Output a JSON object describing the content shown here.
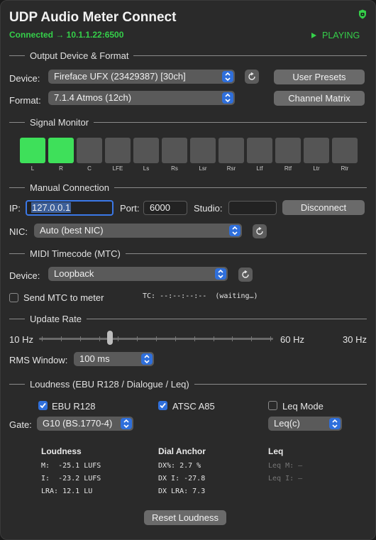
{
  "app_title": "UDP Audio Meter Connect",
  "status": "Connected → 10.1.1.22:6500",
  "playing_label": "PLAYING",
  "colors": {
    "accent_green": "#35d04a",
    "meter_on": "#3ee05a",
    "meter_off": "#555555",
    "select_blue": "#2f6fdb"
  },
  "output": {
    "section_title": "Output Device & Format",
    "device_label": "Device:",
    "device_value": "Fireface UFX (23429387)  [30ch]",
    "format_label": "Format:",
    "format_value": "7.1.4 Atmos (12ch)",
    "user_presets_label": "User Presets",
    "channel_matrix_label": "Channel Matrix"
  },
  "signal_monitor": {
    "section_title": "Signal Monitor",
    "channels": [
      {
        "name": "L",
        "active": true
      },
      {
        "name": "R",
        "active": true
      },
      {
        "name": "C",
        "active": false
      },
      {
        "name": "LFE",
        "active": false
      },
      {
        "name": "Ls",
        "active": false
      },
      {
        "name": "Rs",
        "active": false
      },
      {
        "name": "Lsr",
        "active": false
      },
      {
        "name": "Rsr",
        "active": false
      },
      {
        "name": "Ltf",
        "active": false
      },
      {
        "name": "Rtf",
        "active": false
      },
      {
        "name": "Ltr",
        "active": false
      },
      {
        "name": "Rtr",
        "active": false
      }
    ]
  },
  "manual": {
    "section_title": "Manual Connection",
    "ip_label": "IP:",
    "ip_value": "127.0.0.1",
    "port_label": "Port:",
    "port_value": "6000",
    "studio_label": "Studio:",
    "studio_value": "",
    "disconnect_label": "Disconnect",
    "nic_label": "NIC:",
    "nic_value": "Auto (best NIC)"
  },
  "midi": {
    "section_title": "MIDI Timecode (MTC)",
    "device_label": "Device:",
    "device_value": "Loopback",
    "send_mtc_label": "Send MTC to meter",
    "send_mtc_checked": false,
    "tc_text": "TC: --:--:--:--  (waiting…)"
  },
  "update_rate": {
    "section_title": "Update Rate",
    "min_label": "10 Hz",
    "max_label": "60 Hz",
    "current_label": "30 Hz",
    "slider_value_hz": 30,
    "slider_min_hz": 10,
    "slider_max_hz": 60,
    "rms_label": "RMS Window:",
    "rms_value": "100 ms"
  },
  "loudness": {
    "section_title": "Loudness (EBU R128 / Dialogue / Leq)",
    "ebu_label": "EBU R128",
    "ebu_checked": true,
    "atsc_label": "ATSC A85",
    "atsc_checked": true,
    "leq_mode_label": "Leq Mode",
    "leq_mode_checked": false,
    "gate_label": "Gate:",
    "gate_value": "G10 (BS.1770-4)",
    "leq_weight_value": "Leq(c)",
    "col_loudness": "Loudness",
    "col_dial": "Dial Anchor",
    "col_leq": "Leq",
    "loudness_rows": [
      "M:  -25.1 LUFS",
      "I:  -23.2 LUFS",
      "LRA: 12.1 LU"
    ],
    "dial_rows": [
      "DX%: 2.7 %",
      "DX I: -27.8",
      "DX LRA: 7.3"
    ],
    "leq_rows": [
      "Leq M: —",
      "Leq I: —"
    ],
    "reset_label": "Reset Loudness"
  }
}
